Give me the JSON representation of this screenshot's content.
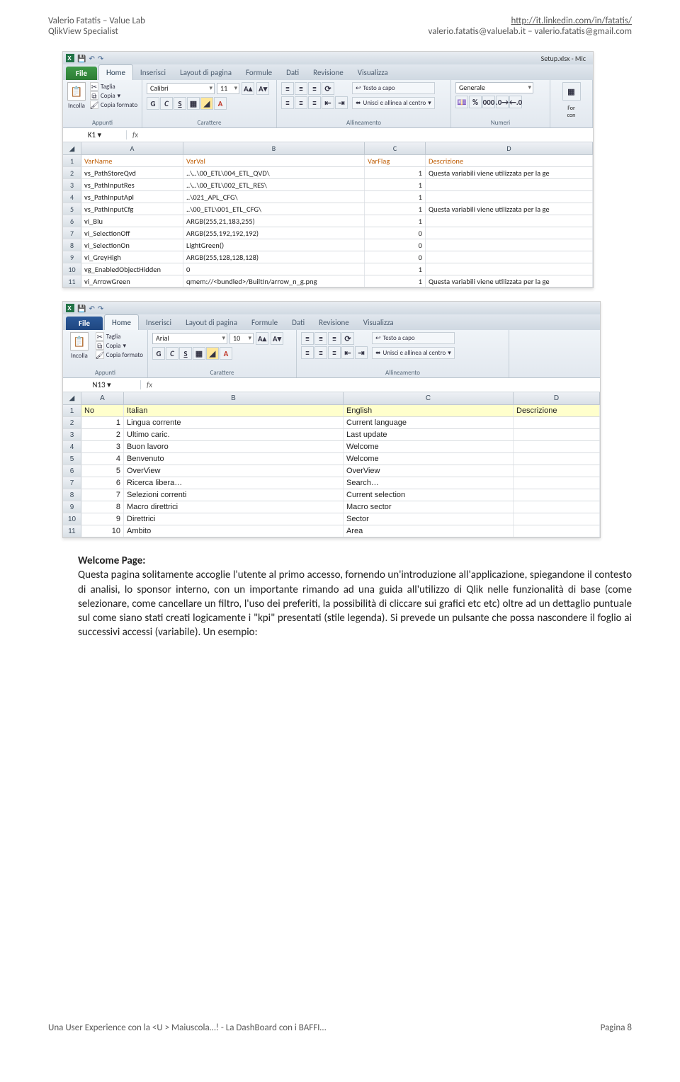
{
  "doc": {
    "author": "Valerio Fatatis – Value Lab",
    "role": "QlikView Specialist",
    "linkedin": "http://it.linkedin.com/in/fatatis/",
    "emails": "valerio.fatatis@valuelab.it – valerio.fatatis@gmail.com",
    "footer_left": "Una User Experience con la <U > Maiuscola…! - La DashBoard con i BAFFI…",
    "footer_right": "Pagina 8"
  },
  "ss1": {
    "title_right": "Setup.xlsx - Mic",
    "file_label": "File",
    "tabs": [
      "Home",
      "Inserisci",
      "Layout di pagina",
      "Formule",
      "Dati",
      "Revisione",
      "Visualizza"
    ],
    "ribbon_groups": [
      "Appunti",
      "Carattere",
      "Allineamento",
      "Numeri"
    ],
    "clipboard": {
      "paste": "Incolla",
      "cut": "Taglia",
      "copy": "Copia",
      "fmt": "Copia formato"
    },
    "font": {
      "name": "Calibri",
      "size": "11"
    },
    "align": {
      "wrap": "Testo a capo",
      "merge": "Unisci e allinea al centro"
    },
    "number": {
      "fmt": "Generale"
    },
    "namebox": "K1",
    "cols": [
      "A",
      "B",
      "C",
      "D"
    ],
    "headers": [
      "VarName",
      "VarVal",
      "VarFlag",
      "Descrizione"
    ],
    "rows": [
      [
        "vs_PathStoreQvd",
        "..\\..\\00_ETL\\004_ETL_QVD\\",
        "1",
        "Questa variabili viene utilizzata per la ge"
      ],
      [
        "vs_PathInputRes",
        "..\\..\\00_ETL\\002_ETL_RES\\",
        "1",
        ""
      ],
      [
        "vs_PathInputApl",
        "..\\021_APL_CFG\\",
        "1",
        ""
      ],
      [
        "vs_PathInputCfg",
        "..\\00_ETL\\001_ETL_CFG\\",
        "1",
        "Questa variabili viene utilizzata per la ge"
      ],
      [
        "vi_Blu",
        "ARGB(255,21,183,255)",
        "1",
        ""
      ],
      [
        "vi_SelectionOff",
        "ARGB(255,192,192,192)",
        "0",
        ""
      ],
      [
        "vi_SelectionOn",
        "LightGreen()",
        "0",
        ""
      ],
      [
        "vi_GreyHigh",
        "ARGB(255,128,128,128)",
        "0",
        ""
      ],
      [
        "vg_EnabledObjectHidden",
        "0",
        "1",
        ""
      ],
      [
        "vi_ArrowGreen",
        "qmem://<bundled>/BuiltIn/arrow_n_g.png",
        "1",
        "Questa variabili viene utilizzata per la ge"
      ]
    ]
  },
  "ss2": {
    "file_label": "File",
    "tabs": [
      "Home",
      "Inserisci",
      "Layout di pagina",
      "Formule",
      "Dati",
      "Revisione",
      "Visualizza"
    ],
    "ribbon_groups": [
      "Appunti",
      "Carattere",
      "Allineamento"
    ],
    "clipboard": {
      "paste": "Incolla",
      "cut": "Taglia",
      "copy": "Copia",
      "fmt": "Copia formato"
    },
    "font": {
      "name": "Arial",
      "size": "10"
    },
    "align": {
      "wrap": "Testo a capo",
      "merge": "Unisci e allinea al centro"
    },
    "namebox": "N13",
    "cols": [
      "A",
      "B",
      "C",
      "D"
    ],
    "headers": [
      "No",
      "Italian",
      "English",
      "Descrizione"
    ],
    "rows": [
      [
        "1",
        "Lingua corrente",
        "Current language",
        ""
      ],
      [
        "2",
        "Ultimo caric.",
        "Last update",
        ""
      ],
      [
        "3",
        "Buon lavoro",
        "Welcome",
        ""
      ],
      [
        "4",
        "Benvenuto",
        "Welcome",
        ""
      ],
      [
        "5",
        "OverView",
        "OverView",
        ""
      ],
      [
        "6",
        "Ricerca libera…",
        "Search…",
        ""
      ],
      [
        "7",
        "Selezioni correnti",
        "Current selection",
        ""
      ],
      [
        "8",
        "Macro direttrici",
        "Macro sector",
        ""
      ],
      [
        "9",
        "Direttrici",
        "Sector",
        ""
      ],
      [
        "10",
        "Ambito",
        "Area",
        ""
      ]
    ]
  },
  "body": {
    "heading": "Welcome Page:",
    "text": "Questa pagina solitamente accoglie l'utente al primo accesso, fornendo un'introduzione all'applicazione, spiegandone il contesto di analisi, lo sponsor interno, con un importante rimando ad una guida all'utilizzo di Qlik nelle funzionalità di base (come selezionare, come cancellare un filtro, l'uso dei preferiti, la possibilità di cliccare sui grafici etc etc) oltre ad un dettaglio puntuale sul come siano stati creati logicamente i \"kpi\" presentati (stile legenda). Si prevede un pulsante che possa nascondere il foglio ai successivi accessi (variabile). Un esempio:"
  }
}
